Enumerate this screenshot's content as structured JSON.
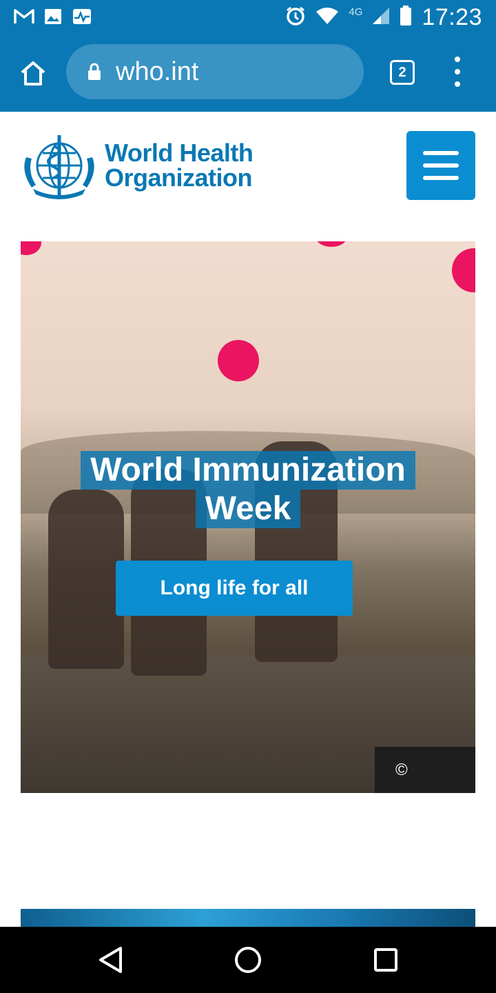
{
  "status_bar": {
    "time": "17:23",
    "network": "4G",
    "left_icons": [
      "gmail-icon",
      "gallery-icon",
      "activity-icon"
    ],
    "right_icons": [
      "alarm-icon",
      "wifi-icon",
      "signal-icon",
      "battery-icon"
    ]
  },
  "browser": {
    "url": "who.int",
    "tab_count": "2"
  },
  "header": {
    "logo_line1": "World Health",
    "logo_line2": "Organization"
  },
  "hero": {
    "title_line1": "World Immunization",
    "title_line2": "Week",
    "cta_label": "Long life for all",
    "credit": "©"
  },
  "colors": {
    "brand_blue": "#0a78b4",
    "button_blue": "#0b8dd1",
    "accent_pink": "#ea1461"
  }
}
